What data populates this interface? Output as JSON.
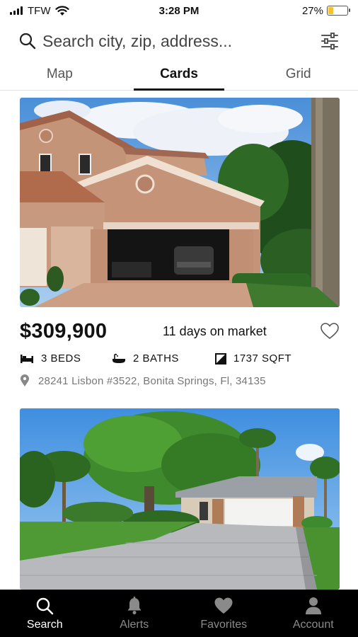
{
  "status_bar": {
    "carrier": "TFW",
    "time": "3:28 PM",
    "battery": "27%",
    "battery_level": 0.27
  },
  "search": {
    "placeholder": "Search city, zip, address..."
  },
  "tabs": [
    {
      "label": "Map",
      "active": false
    },
    {
      "label": "Cards",
      "active": true
    },
    {
      "label": "Grid",
      "active": false
    }
  ],
  "listings": [
    {
      "price": "$309,900",
      "days_on_market": "11 days on market",
      "beds": "3 BEDS",
      "baths": "2 BATHS",
      "sqft": "1737 SQFT",
      "address": "28241 Lisbon #3522, Bonita Springs, Fl, 34135"
    }
  ],
  "bottom_nav": [
    {
      "label": "Search",
      "icon": "search-icon",
      "active": true
    },
    {
      "label": "Alerts",
      "icon": "bell-icon",
      "active": false
    },
    {
      "label": "Favorites",
      "icon": "heart-icon",
      "active": false
    },
    {
      "label": "Account",
      "icon": "person-icon",
      "active": false
    }
  ],
  "colors": {
    "battery": "#f2c230",
    "nav_background": "#000000",
    "nav_active": "#ffffff",
    "nav_inactive": "#8a8a8a"
  }
}
